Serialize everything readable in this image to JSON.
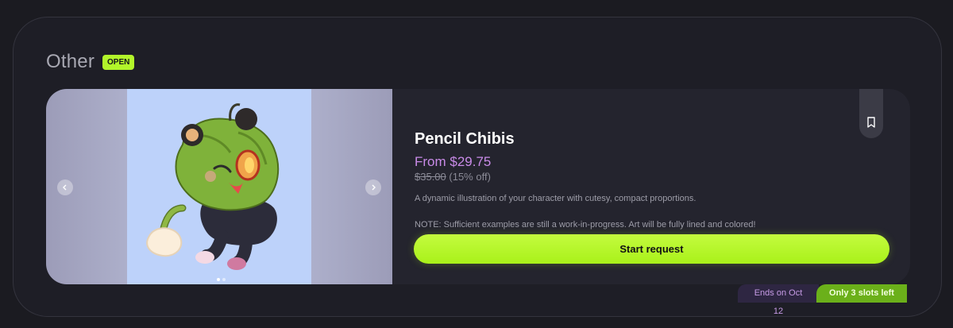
{
  "section": {
    "title": "Other",
    "status_badge": "OPEN"
  },
  "product": {
    "title": "Pencil Chibis",
    "price": "From $29.75",
    "original_price": "$35.00",
    "discount": "(15% off)",
    "description": "A dynamic illustration of your character with cutesy, compact proportions.",
    "note": "NOTE: Sufficient examples are still a work-in-progress. Art will be fully lined and colored!",
    "cta_label": "Start request",
    "ends_label": "Ends on Oct 12",
    "slots_label": "Only 3 slots left"
  },
  "gallery": {
    "image_count": 2,
    "active_index": 0,
    "prev_icon": "chevron-left-icon",
    "next_icon": "chevron-right-icon"
  },
  "icons": {
    "bookmark": "bookmark-icon"
  },
  "colors": {
    "accent_green": "#b2f52a",
    "price_purple": "#c98be8",
    "card_bg": "#24242e",
    "page_bg": "#1b1b21"
  }
}
